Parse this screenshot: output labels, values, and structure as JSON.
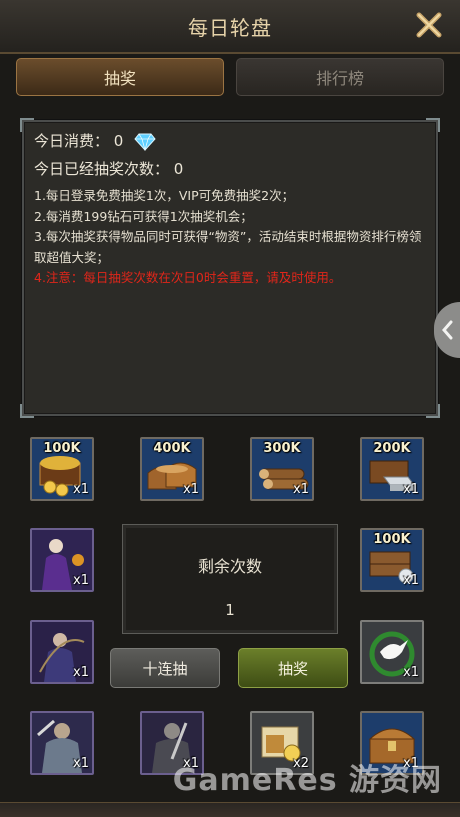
{
  "header": {
    "title": "每日轮盘"
  },
  "tabs": [
    {
      "label": "抽奖",
      "active": true
    },
    {
      "label": "排行榜",
      "active": false
    }
  ],
  "info": {
    "consumption_label": "今日消费：",
    "consumption_value": "0",
    "draws_label": "今日已经抽奖次数：",
    "draws_value": "0",
    "rules": [
      "1.每日登录免费抽奖1次，VIP可免费抽奖2次；",
      "2.每消费199钻石可获得1次抽奖机会；",
      "3.每次抽奖获得物品同时可获得“物资”，活动结束时根据物资排行榜领取超值大奖；"
    ],
    "warning": "4.注意：每日抽奖次数在次日0时会重置，请及时使用。",
    "warning_color": "#e0261a"
  },
  "rewards": [
    {
      "icon": "gold-chest-icon",
      "amount": "100K",
      "qty": "x1"
    },
    {
      "icon": "grain-sacks-icon",
      "amount": "400K",
      "qty": "x1"
    },
    {
      "icon": "wood-logs-icon",
      "amount": "300K",
      "qty": "x1"
    },
    {
      "icon": "iron-ingots-icon",
      "amount": "200K",
      "qty": "x1"
    },
    {
      "icon": "sorceress-hero-icon",
      "amount": "",
      "qty": "x1"
    },
    {
      "icon": "silver-crate-icon",
      "amount": "100K",
      "qty": "x1"
    },
    {
      "icon": "archer-hero-icon",
      "amount": "",
      "qty": "x1"
    },
    {
      "icon": "peace-dove-icon",
      "amount": "",
      "qty": "x1"
    },
    {
      "icon": "knight-hero-icon",
      "amount": "",
      "qty": "x1"
    },
    {
      "icon": "swordsman-hero-icon",
      "amount": "",
      "qty": "x1"
    },
    {
      "icon": "speedup-scroll-icon",
      "amount": "",
      "qty": "x2"
    },
    {
      "icon": "treasure-chest-icon",
      "amount": "",
      "qty": "x1"
    }
  ],
  "remaining": {
    "label": "剩余次数",
    "value": "1"
  },
  "buttons": {
    "ten_draw": "十连抽",
    "draw": "抽奖"
  },
  "watermark": "GameRes 游资网",
  "colors": {
    "accent_gold": "#e6d3a9",
    "draw_button": "#6b7f2a"
  }
}
